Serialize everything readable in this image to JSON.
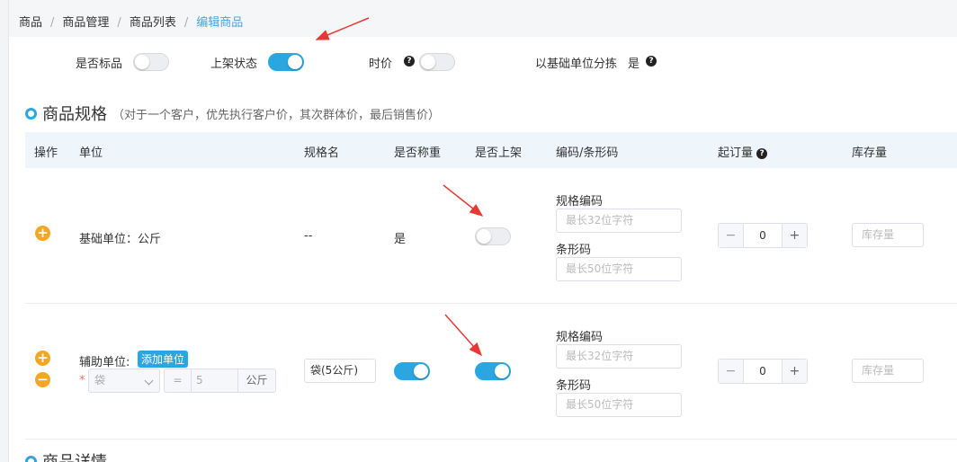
{
  "breadcrumb": {
    "items": [
      "商品",
      "商品管理",
      "商品列表",
      "编辑商品"
    ],
    "separator": "/"
  },
  "flags": {
    "standard_label": "是否标品",
    "standard_on": false,
    "listing_label": "上架状态",
    "listing_on": true,
    "seasonal_label": "时价",
    "seasonal_on": false,
    "sort_by_base_label": "以基础单位分拣",
    "sort_by_base_value": "是"
  },
  "section": {
    "title": "商品规格",
    "note": "（对于一个客户，优先执行客户价，其次群体价，最后销售价）"
  },
  "table": {
    "headers": {
      "action": "操作",
      "unit": "单位",
      "spec_name": "规格名",
      "weighed": "是否称重",
      "listed": "是否上架",
      "code": "编码/条形码",
      "min_order": "起订量",
      "stock": "库存量"
    },
    "rows": [
      {
        "unit_text": "基础单位：公斤",
        "spec_name": "--",
        "weighed_text": "是",
        "listed_on": false,
        "spec_code_label": "规格编码",
        "spec_code_placeholder": "最长32位字符",
        "barcode_label": "条形码",
        "barcode_placeholder": "最长50位字符",
        "min_order": "0",
        "stock_placeholder": "库存量"
      },
      {
        "unit_label": "辅助单位:",
        "add_unit": "添加单位",
        "req": "*",
        "unit_select": "袋",
        "eq": "=",
        "conv_num": "5",
        "conv_unit": "公斤",
        "spec_name": "袋(5公斤)",
        "weighed_on": true,
        "listed_on": true,
        "spec_code_label": "规格编码",
        "spec_code_placeholder": "最长32位字符",
        "barcode_label": "条形码",
        "barcode_placeholder": "最长50位字符",
        "min_order": "0",
        "stock_placeholder": "库存量"
      }
    ]
  },
  "next_section_title": "商品详情",
  "icons": {
    "add": "+",
    "remove": "−",
    "help": "?",
    "stepper_minus": "−",
    "stepper_plus": "+"
  },
  "colors": {
    "accent": "#2aa7e1",
    "orange": "#f5a623",
    "arrow": "#e53935"
  }
}
